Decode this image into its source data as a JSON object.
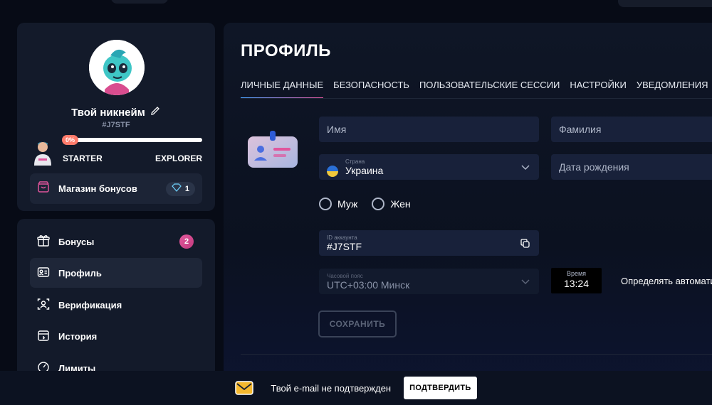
{
  "profile": {
    "nickname": "Твой никнейм",
    "user_id": "#J7STF",
    "progress_label": "0%",
    "progress_percent": 0,
    "level_current": "STARTER",
    "level_next": "EXPLORER",
    "bonus_shop_label": "Магазин бонусов",
    "gems_count": "1"
  },
  "nav": {
    "items": [
      {
        "label": "Бонусы",
        "icon": "gift-icon",
        "badge": "2"
      },
      {
        "label": "Профиль",
        "icon": "id-card-icon"
      },
      {
        "label": "Верификация",
        "icon": "face-scan-icon"
      },
      {
        "label": "История",
        "icon": "history-icon"
      },
      {
        "label": "Лимиты",
        "icon": "gauge-icon"
      }
    ]
  },
  "main": {
    "title": "ПРОФИЛЬ",
    "tabs": [
      {
        "label": "ЛИЧНЫЕ ДАННЫЕ",
        "active": true
      },
      {
        "label": "БЕЗОПАСНОСТЬ"
      },
      {
        "label": "ПОЛЬЗОВАТЕЛЬСКИЕ СЕССИИ"
      },
      {
        "label": "НАСТРОЙКИ"
      },
      {
        "label": "УВЕДОМЛЕНИЯ"
      }
    ],
    "form": {
      "first_name_placeholder": "Имя",
      "last_name_placeholder": "Фамилия",
      "country_label": "Страна",
      "country_value": "Украина",
      "birthdate_placeholder": "Дата рождения",
      "gender_male": "Муж",
      "gender_female": "Жен",
      "account_id_label": "ID аккаунта",
      "account_id_value": "#J7STF",
      "timezone_label": "Часовой пояс",
      "timezone_value": "UTC+03:00 Минск",
      "time_label": "Время",
      "time_value": "13:24",
      "auto_detect_label": "Определять автомати",
      "save_label": "СОХРАНИТЬ"
    }
  },
  "banner": {
    "text": "Твой e-mail не подтвержден",
    "confirm_label": "ПОДТВЕРДИТЬ"
  },
  "colors": {
    "accent_pink": "#e0559c",
    "accent_blue": "#4aa3ff",
    "progress": "#ff7b6b"
  }
}
